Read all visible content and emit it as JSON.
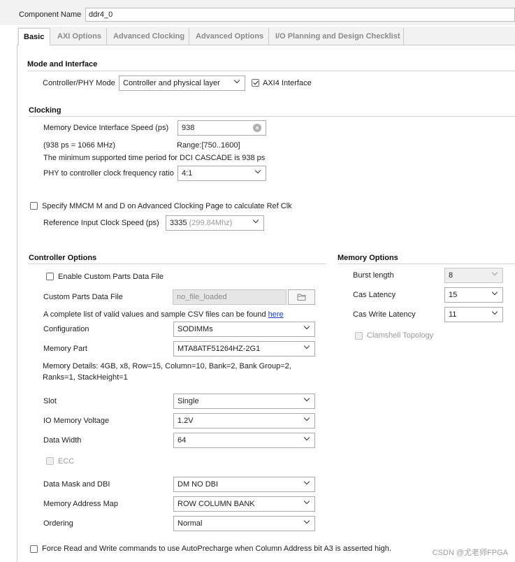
{
  "component": {
    "label": "Component Name",
    "value": "ddr4_0"
  },
  "tabs": [
    {
      "label": "Basic",
      "active": true
    },
    {
      "label": "AXI Options",
      "active": false
    },
    {
      "label": "Advanced Clocking",
      "active": false
    },
    {
      "label": "Advanced Options",
      "active": false
    },
    {
      "label": "I/O Planning and Design Checklist",
      "active": false
    }
  ],
  "mode": {
    "title": "Mode and Interface",
    "ctrl_phy_label": "Controller/PHY Mode",
    "ctrl_phy_value": "Controller and physical layer",
    "axi4_label": "AXI4 Interface",
    "axi4_checked": true
  },
  "clocking": {
    "title": "Clocking",
    "speed_label": "Memory Device Interface Speed (ps)",
    "speed_value": "938",
    "freq_note": "(938 ps = 1066 MHz)",
    "range_note": "Range:[750..1600]",
    "min_note": "The minimum supported time period for DCI CASCADE is 938 ps",
    "ratio_label": "PHY to controller clock frequency ratio",
    "ratio_value": "4:1",
    "mmcm_label": "Specify MMCM M and D on Advanced Clocking Page to calculate Ref Clk",
    "mmcm_checked": false,
    "ref_label": "Reference Input Clock Speed (ps)",
    "ref_value": "3335",
    "ref_hint": "(299.84Mhz)"
  },
  "controller": {
    "title": "Controller Options",
    "custom_parts_label": "Enable Custom Parts Data File",
    "custom_parts_checked": false,
    "custom_file_label": "Custom Parts Data File",
    "custom_file_placeholder": "no_file_loaded",
    "csv_note": "A complete list of valid values and sample CSV files can be found",
    "csv_link": "here",
    "configuration_label": "Configuration",
    "configuration_value": "SODIMMs",
    "memory_part_label": "Memory Part",
    "memory_part_value": "MTA8ATF51264HZ-2G1",
    "details_line1": "Memory Details: 4GB, x8, Row=15, Column=10, Bank=2, Bank Group=2,",
    "details_line2": "Ranks=1, StackHeight=1",
    "slot_label": "Slot",
    "slot_value": "Single",
    "voltage_label": "IO Memory Voltage",
    "voltage_value": "1.2V",
    "width_label": "Data Width",
    "width_value": "64",
    "ecc_label": "ECC",
    "dm_label": "Data Mask and DBI",
    "dm_value": "DM NO DBI",
    "addr_map_label": "Memory Address Map",
    "addr_map_value": "ROW COLUMN BANK",
    "ordering_label": "Ordering",
    "ordering_value": "Normal"
  },
  "memory_options": {
    "title": "Memory Options",
    "burst_label": "Burst length",
    "burst_value": "8",
    "cas_label": "Cas Latency",
    "cas_value": "15",
    "cwl_label": "Cas Write Latency",
    "cwl_value": "11",
    "clamshell_label": "Clamshell Topology"
  },
  "force_read": {
    "label": "Force Read and Write commands to use AutoPrecharge when Column Address bit A3 is asserted high.",
    "checked": false
  },
  "watermark": "CSDN @尤老师FPGA"
}
